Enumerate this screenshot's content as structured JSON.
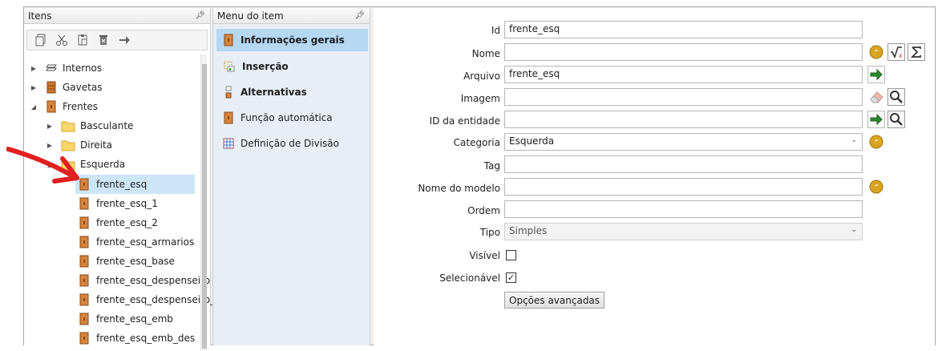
{
  "items_panel": {
    "title": "Itens",
    "pin_icon": "pin-icon",
    "toolbar": [
      "copy-icon",
      "cut-icon",
      "paste-icon",
      "delete-icon",
      "arrow-right-icon"
    ],
    "tree": [
      {
        "label": "Internos",
        "icon": "layers-icon"
      },
      {
        "label": "Gavetas",
        "icon": "drawer-icon"
      },
      {
        "label": "Frentes",
        "icon": "door-icon"
      },
      {
        "label": "Basculante",
        "icon": "folder-icon"
      },
      {
        "label": "Direita",
        "icon": "folder-icon"
      },
      {
        "label": "Esquerda",
        "icon": "folder-icon"
      },
      {
        "label": "frente_esq",
        "icon": "door-icon"
      },
      {
        "label": "frente_esq_1",
        "icon": "door-icon"
      },
      {
        "label": "frente_esq_2",
        "icon": "door-icon"
      },
      {
        "label": "frente_esq_armarios",
        "icon": "door-icon"
      },
      {
        "label": "frente_esq_base",
        "icon": "door-icon"
      },
      {
        "label": "frente_esq_despenseiro",
        "icon": "door-icon"
      },
      {
        "label": "frente_esq_despenseiro_",
        "icon": "door-icon"
      },
      {
        "label": "frente_esq_emb",
        "icon": "door-icon"
      },
      {
        "label": "frente_esq_emb_des",
        "icon": "door-icon"
      }
    ]
  },
  "menu_panel": {
    "title": "Menu do item",
    "items": [
      {
        "label": "Informações gerais",
        "icon": "door-icon"
      },
      {
        "label": "Inserção",
        "icon": "insert-icon"
      },
      {
        "label": "Alternativas",
        "icon": "alternatives-icon"
      },
      {
        "label": "Função automática",
        "icon": "door-icon"
      },
      {
        "label": "Definição de Divisão",
        "icon": "grid-icon"
      }
    ]
  },
  "form": {
    "labels": {
      "id": "Id",
      "nome": "Nome",
      "arquivo": "Arquivo",
      "imagem": "Imagem",
      "id_entidade": "ID da entidade",
      "categoria": "Categoria",
      "tag": "Tag",
      "nome_modelo": "Nome do modelo",
      "ordem": "Ordem",
      "tipo": "Tipo",
      "visivel": "Visível",
      "selecionavel": "Selecionável"
    },
    "values": {
      "id": "frente_esq",
      "nome": "",
      "arquivo": "frente_esq",
      "imagem": "",
      "id_entidade": "",
      "categoria": "Esquerda",
      "tag": "",
      "nome_modelo": "",
      "ordem": "",
      "tipo": "Simples",
      "visivel": false,
      "selecionavel": true
    },
    "advanced_button": "Opções avançadas"
  },
  "colors": {
    "selection": "#cde6f7",
    "menu_active": "#b5d7f2",
    "menu_bg": "#e8eef5",
    "annotation_arrow": "#e02020"
  }
}
